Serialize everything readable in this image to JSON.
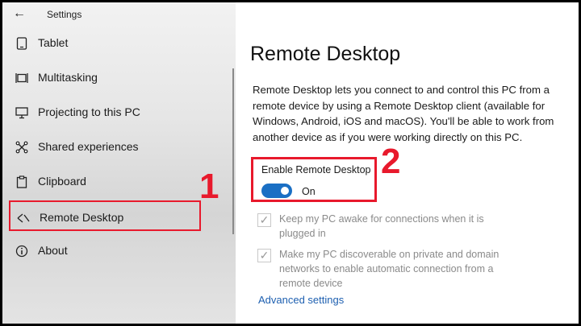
{
  "app": {
    "title": "Settings"
  },
  "icons": {
    "back": "back-arrow-icon"
  },
  "sidebar": {
    "items": [
      {
        "label": "Tablet",
        "icon": "tablet-icon"
      },
      {
        "label": "Multitasking",
        "icon": "multitasking-icon"
      },
      {
        "label": "Projecting to this PC",
        "icon": "projecting-icon"
      },
      {
        "label": "Shared experiences",
        "icon": "shared-experiences-icon"
      },
      {
        "label": "Clipboard",
        "icon": "clipboard-icon"
      },
      {
        "label": "Remote Desktop",
        "icon": "remote-desktop-icon",
        "selected": true
      },
      {
        "label": "About",
        "icon": "info-icon"
      }
    ]
  },
  "annotations": {
    "step1": "1",
    "step2": "2",
    "color": "#e8192c"
  },
  "main": {
    "title": "Remote Desktop",
    "description": "Remote Desktop lets you connect to and control this PC from a remote device by using a Remote Desktop client (available for Windows, Android, iOS and macOS). You'll be able to work from another device as if you were working directly on this PC.",
    "enable": {
      "label": "Enable Remote Desktop",
      "state": "On",
      "on": true,
      "accent": "#1a6fc4"
    },
    "options": [
      {
        "text": "Keep my PC awake for connections when it is plugged in",
        "checked": true,
        "disabled": true
      },
      {
        "text": "Make my PC discoverable on private and domain networks to enable automatic connection from a remote device",
        "checked": true,
        "disabled": true
      }
    ],
    "advanced_link": "Advanced settings"
  }
}
